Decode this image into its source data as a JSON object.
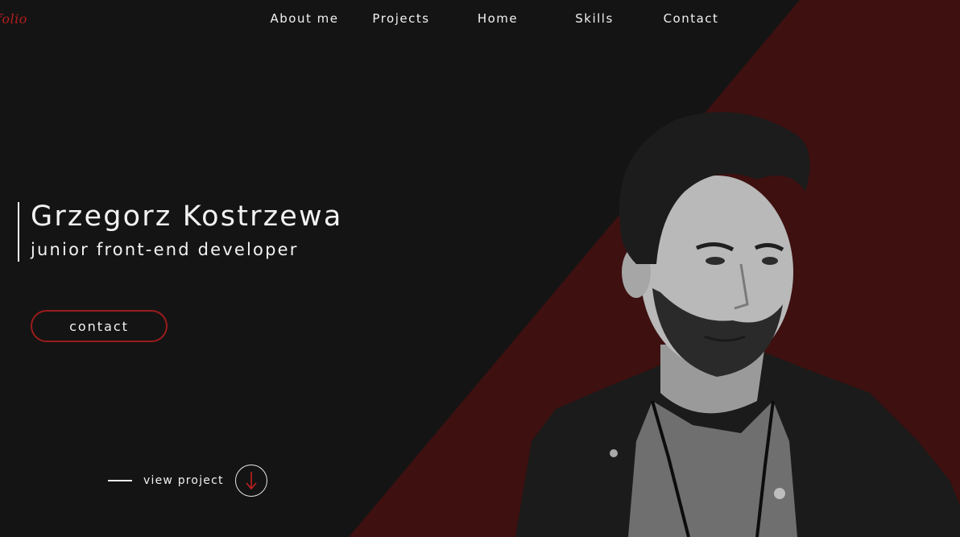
{
  "logo": {
    "text": "folio"
  },
  "nav": {
    "items": [
      {
        "label": "About me"
      },
      {
        "label": "Projects"
      },
      {
        "label": "Home"
      },
      {
        "label": "Skills"
      },
      {
        "label": "Contact"
      }
    ]
  },
  "hero": {
    "name": "Grzegorz Kostrzewa",
    "role": "junior front-end developer",
    "contact_label": "contact"
  },
  "view_project": {
    "label": "view project",
    "icon": "arrow-down-icon"
  },
  "portrait": {
    "icon": "person-photo"
  },
  "colors": {
    "background": "#141414",
    "accent": "#9b1c1c",
    "diagonal": "#3e1010",
    "text": "#f2f2f2"
  }
}
